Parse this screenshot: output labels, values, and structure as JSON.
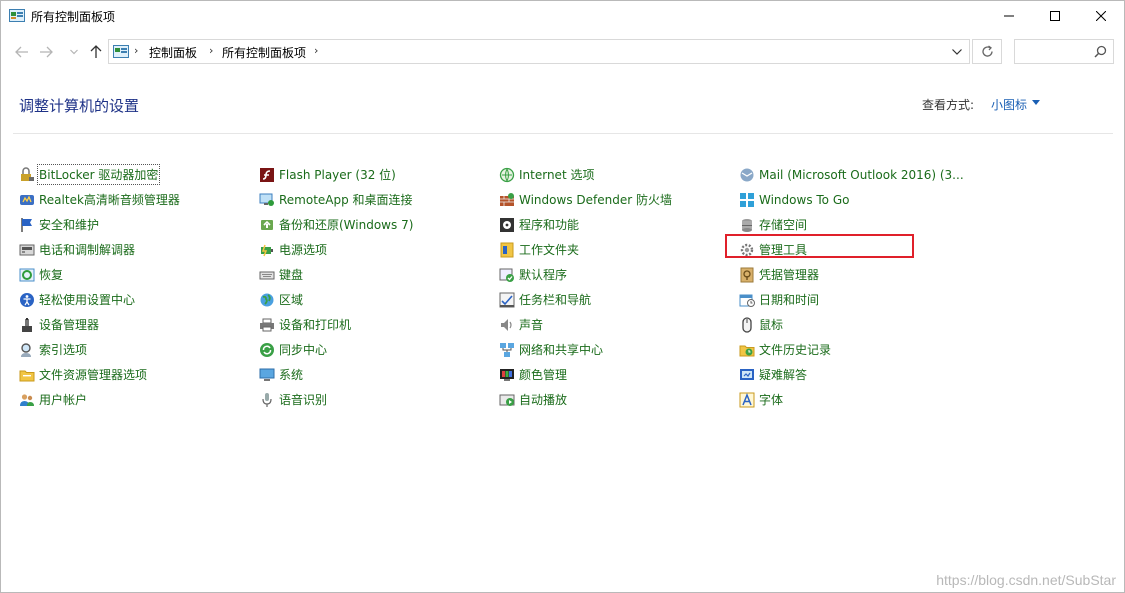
{
  "window": {
    "title": "所有控制面板项"
  },
  "addressbar": {
    "breadcrumb": [
      "控制面板",
      "所有控制面板项"
    ],
    "search_placeholder": ""
  },
  "header": {
    "heading": "调整计算机的设置",
    "view_by_label": "查看方式:",
    "view_by_value": "小图标"
  },
  "columns": [
    [
      {
        "label": "BitLocker 驱动器加密",
        "icon": "bitlocker-icon"
      },
      {
        "label": "Realtek高清晰音频管理器",
        "icon": "realtek-audio-icon"
      },
      {
        "label": "安全和维护",
        "icon": "flag-icon"
      },
      {
        "label": "电话和调制解调器",
        "icon": "phone-modem-icon"
      },
      {
        "label": "恢复",
        "icon": "recovery-icon"
      },
      {
        "label": "轻松使用设置中心",
        "icon": "ease-of-access-icon"
      },
      {
        "label": "设备管理器",
        "icon": "device-manager-icon"
      },
      {
        "label": "索引选项",
        "icon": "indexing-icon"
      },
      {
        "label": "文件资源管理器选项",
        "icon": "folder-options-icon"
      },
      {
        "label": "用户帐户",
        "icon": "user-accounts-icon"
      }
    ],
    [
      {
        "label": "Flash Player (32 位)",
        "icon": "flash-icon"
      },
      {
        "label": "RemoteApp 和桌面连接",
        "icon": "remoteapp-icon"
      },
      {
        "label": "备份和还原(Windows 7)",
        "icon": "backup-icon"
      },
      {
        "label": "电源选项",
        "icon": "power-icon"
      },
      {
        "label": "键盘",
        "icon": "keyboard-icon"
      },
      {
        "label": "区域",
        "icon": "region-icon"
      },
      {
        "label": "设备和打印机",
        "icon": "printer-icon"
      },
      {
        "label": "同步中心",
        "icon": "sync-icon"
      },
      {
        "label": "系统",
        "icon": "system-icon"
      },
      {
        "label": "语音识别",
        "icon": "microphone-icon"
      }
    ],
    [
      {
        "label": "Internet 选项",
        "icon": "internet-options-icon"
      },
      {
        "label": "Windows Defender 防火墙",
        "icon": "firewall-icon"
      },
      {
        "label": "程序和功能",
        "icon": "programs-icon"
      },
      {
        "label": "工作文件夹",
        "icon": "work-folders-icon"
      },
      {
        "label": "默认程序",
        "icon": "default-programs-icon"
      },
      {
        "label": "任务栏和导航",
        "icon": "taskbar-icon"
      },
      {
        "label": "声音",
        "icon": "speaker-icon"
      },
      {
        "label": "网络和共享中心",
        "icon": "network-icon"
      },
      {
        "label": "颜色管理",
        "icon": "color-management-icon"
      },
      {
        "label": "自动播放",
        "icon": "autoplay-icon"
      }
    ],
    [
      {
        "label": "Mail (Microsoft Outlook 2016) (3...",
        "icon": "mail-icon"
      },
      {
        "label": "Windows To Go",
        "icon": "windows-to-go-icon"
      },
      {
        "label": "存储空间",
        "icon": "storage-spaces-icon"
      },
      {
        "label": "管理工具",
        "icon": "admin-tools-icon"
      },
      {
        "label": "凭据管理器",
        "icon": "credential-manager-icon"
      },
      {
        "label": "日期和时间",
        "icon": "date-time-icon"
      },
      {
        "label": "鼠标",
        "icon": "mouse-icon"
      },
      {
        "label": "文件历史记录",
        "icon": "file-history-icon"
      },
      {
        "label": "疑难解答",
        "icon": "troubleshooting-icon"
      },
      {
        "label": "字体",
        "icon": "fonts-icon"
      }
    ]
  ],
  "colors": {
    "link": "#1a6b1a",
    "heading": "#1e3287",
    "accent": "#1a5fb4",
    "highlight": "#e0202a"
  },
  "watermark": "https://blog.csdn.net/SubStar"
}
